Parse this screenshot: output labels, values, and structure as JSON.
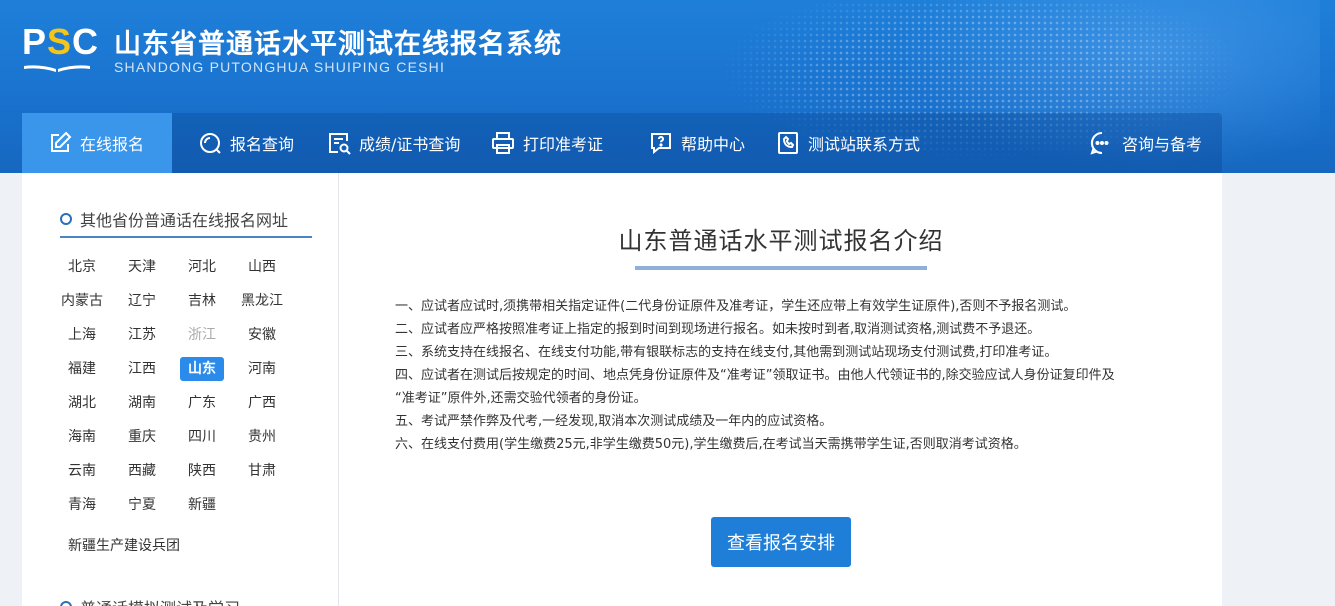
{
  "header": {
    "logo_p": "P",
    "logo_s": "S",
    "logo_c": "C",
    "title": "山东省普通话水平测试在线报名系统",
    "subtitle": "SHANDONG PUTONGHUA SHUIPING CESHI"
  },
  "nav": {
    "items": [
      {
        "label": "在线报名",
        "icon": "edit-icon"
      },
      {
        "label": "报名查询",
        "icon": "search-icon"
      },
      {
        "label": "成绩/证书查询",
        "icon": "certificate-search-icon"
      },
      {
        "label": "打印准考证",
        "icon": "printer-icon"
      },
      {
        "label": "帮助中心",
        "icon": "help-icon"
      },
      {
        "label": "测试站联系方式",
        "icon": "contact-icon"
      },
      {
        "label": "咨询与备考",
        "icon": "chat-icon"
      }
    ],
    "active_index": 0
  },
  "sidebar": {
    "heading": "其他省份普通话在线报名网址",
    "provinces": [
      [
        "北京",
        "天津",
        "河北",
        "山西"
      ],
      [
        "内蒙古",
        "辽宁",
        "吉林",
        "黑龙江"
      ],
      [
        "上海",
        "江苏",
        "浙江",
        "安徽"
      ],
      [
        "福建",
        "江西",
        "山东",
        "河南"
      ],
      [
        "湖北",
        "湖南",
        "广东",
        "广西"
      ],
      [
        "海南",
        "重庆",
        "四川",
        "贵州"
      ],
      [
        "云南",
        "西藏",
        "陕西",
        "甘肃"
      ],
      [
        "青海",
        "宁夏",
        "新疆"
      ]
    ],
    "active_province": "山东",
    "muted_province": "浙江",
    "extra": "新疆生产建设兵团",
    "heading2": "普通话模拟测试及学习"
  },
  "content": {
    "title": "山东普通话水平测试报名介绍",
    "rules": [
      "一、应试者应试时,须携带相关指定证件(二代身份证原件及准考证，学生还应带上有效学生证原件),否则不予报名测试。",
      "二、应试者应严格按照准考证上指定的报到时间到现场进行报名。如未按时到者,取消测试资格,测试费不予退还。",
      "三、系统支持在线报名、在线支付功能,带有银联标志的支持在线支付,其他需到测试站现场支付测试费,打印准考证。",
      "四、应试者在测试后按规定的时间、地点凭身份证原件及“准考证”领取证书。由他人代领证书的,除交验应试人身份证复印件及",
      "“准考证”原件外,还需交验代领者的身份证。",
      "五、考试严禁作弊及代考,一经发现,取消本次测试成绩及一年内的应试资格。",
      "六、在线支付费用(学生缴费25元,非学生缴费50元),学生缴费后,在考试当天需携带学生证,否则取消考试资格。"
    ],
    "button_label": "查看报名安排"
  },
  "colors": {
    "header_blue": "#1a73cf",
    "nav_active": "#3a96ea",
    "button_blue": "#1f7fd8",
    "logo_accent": "#f5c51a"
  }
}
